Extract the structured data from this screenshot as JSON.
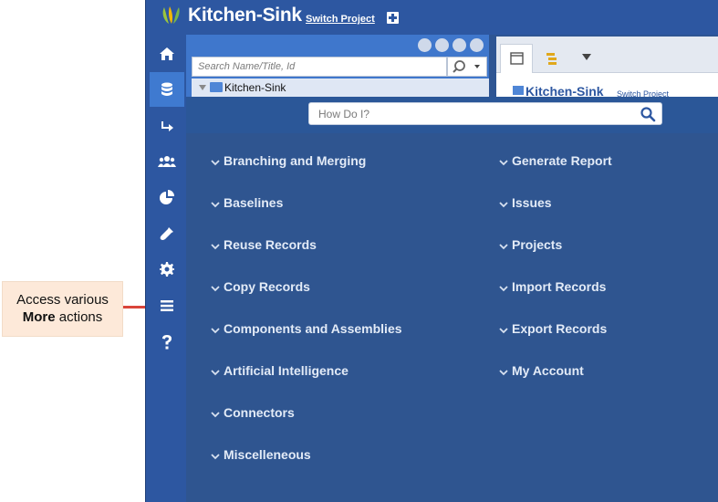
{
  "callout": {
    "line1": "Access various",
    "bold": "More",
    "rest": " actions"
  },
  "app": {
    "title": "Kitchen-Sink",
    "switch_project": "Switch Project"
  },
  "sidebar": {
    "items": [
      {
        "icon": "home-icon"
      },
      {
        "icon": "database-icon",
        "active": true
      },
      {
        "icon": "arrow-right-icon"
      },
      {
        "icon": "users-icon"
      },
      {
        "icon": "pie-chart-icon"
      },
      {
        "icon": "flask-icon"
      },
      {
        "icon": "gear-icon"
      },
      {
        "icon": "menu-icon"
      },
      {
        "icon": "help-icon"
      }
    ]
  },
  "nav": {
    "search_placeholder": "Search Name/Title, Id",
    "tree_root": "Kitchen-Sink"
  },
  "right_panel": {
    "title": "Kitchen-Sink",
    "link": "Switch Project"
  },
  "how_do_i": {
    "placeholder": "How Do I?",
    "left_items": [
      "Branching and Merging",
      "Baselines",
      "Reuse Records",
      "Copy Records",
      "Components and Assemblies",
      "Artificial Intelligence",
      "Connectors",
      "Miscelleneous"
    ],
    "right_items": [
      "Generate Report",
      "Issues",
      "Projects",
      "Import Records",
      "Export Records",
      "My Account"
    ]
  },
  "colors": {
    "brand": "#2d57a1",
    "overlay": "#2f5590",
    "callout_bg": "#fde9d9",
    "arrow": "#d9443a"
  }
}
